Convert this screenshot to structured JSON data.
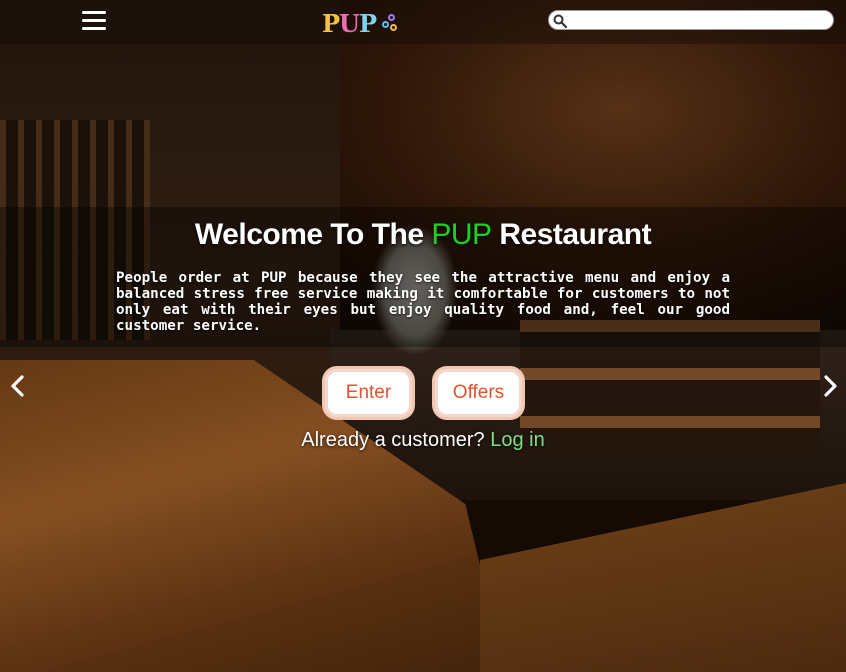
{
  "header": {
    "menu_icon": "hamburger-icon",
    "logo_text_1": "P",
    "logo_text_2": "U",
    "logo_text_3": "P",
    "search_placeholder": "",
    "search_icon": "search-icon"
  },
  "hero": {
    "title_before": "Welcome To The ",
    "title_accent": "PUP",
    "title_after": " Restaurant",
    "description": "People order at PUP because they see the attractive menu and enjoy a balanced stress free service making it comfortable for customers to not only eat with their eyes but enjoy quality food and, feel our good customer service.",
    "enter_label": "Enter",
    "offers_label": "Offers",
    "login_prompt": "Already a customer? ",
    "login_link": "Log in"
  },
  "carousel": {
    "prev_icon": "chevron-left-icon",
    "next_icon": "chevron-right-icon"
  },
  "colors": {
    "accent_green": "#1fd11f",
    "button_text": "#e0532e",
    "login_link": "#7fe07f"
  }
}
